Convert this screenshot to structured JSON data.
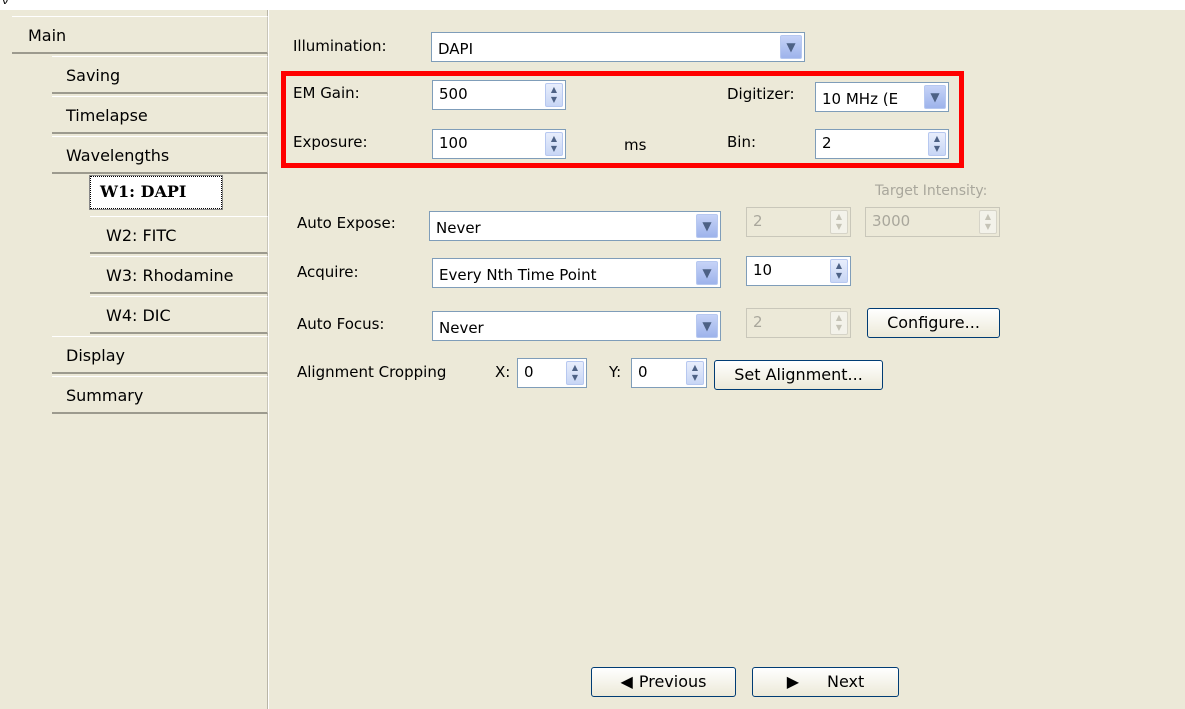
{
  "top_glyph": "ν",
  "nav": {
    "main": "Main",
    "saving": "Saving",
    "timelapse": "Timelapse",
    "wavelengths": "Wavelengths",
    "w1": "W1: DAPI",
    "w2": "W2: FITC",
    "w3": "W3: Rhodamine",
    "w4": "W4: DIC",
    "display": "Display",
    "summary": "Summary"
  },
  "form": {
    "illumination_label": "Illumination:",
    "illumination_value": "DAPI",
    "em_gain_label": "EM Gain:",
    "em_gain_value": "500",
    "digitizer_label": "Digitizer:",
    "digitizer_value": "10 MHz (E",
    "exposure_label": "Exposure:",
    "exposure_value": "100",
    "exposure_unit": "ms",
    "bin_label": "Bin:",
    "bin_value": "2",
    "target_intensity_label": "Target Intensity:",
    "auto_expose_label": "Auto Expose:",
    "auto_expose_value": "Never",
    "auto_expose_n": "2",
    "target_intensity_value": "3000",
    "acquire_label": "Acquire:",
    "acquire_value": "Every Nth Time Point",
    "acquire_n": "10",
    "auto_focus_label": "Auto Focus:",
    "auto_focus_value": "Never",
    "auto_focus_n": "2",
    "configure_label": "Configure...",
    "alignment_label": "Alignment Cropping",
    "x_label": "X:",
    "x_value": "0",
    "y_label": "Y:",
    "y_value": "0",
    "set_alignment_label": "Set Alignment..."
  },
  "footer": {
    "previous_label": "Previous",
    "next_label": "Next"
  },
  "colors": {
    "window_bg": "#ece9d8",
    "highlight_box": "#ff0000"
  }
}
